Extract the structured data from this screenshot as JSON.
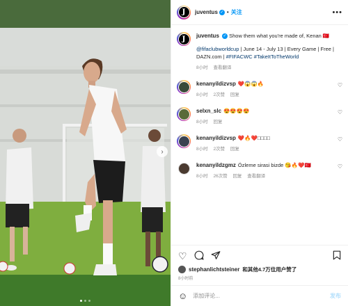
{
  "header": {
    "username": "juventus",
    "verified_mark": "✓",
    "separator": "•",
    "follow_label": "关注",
    "more_label": "•••"
  },
  "photo": {
    "next_label": "›",
    "slide_count": 3,
    "active_slide": 1
  },
  "caption": {
    "username": "juventus",
    "text": "Show them what you're made of, Kenan 🇹🇷",
    "line2_mention": "@fifaclubworldcup",
    "line2_rest": " | June 14 - July 13 | Every Game | Free | DAZN.com | ",
    "line2_tags": "#FIFACWC #TakeItToTheWorld",
    "time": "8小时",
    "translate": "查看翻译"
  },
  "comments": [
    {
      "username": "kenanyildizvsp",
      "text": "❤️😱😱🔥",
      "time": "8小时",
      "likes": "2次赞",
      "reply": "回复"
    },
    {
      "username": "selxn_slc",
      "text": "😍😍😍😍",
      "time": "8小时",
      "likes": "",
      "reply": "回复"
    },
    {
      "username": "kenanyildizvsp",
      "text": "❤️🔥❤️□□□□",
      "time": "8小时",
      "likes": "2次赞",
      "reply": "回复"
    },
    {
      "username": "kenanyildzgmz",
      "text": "Özleme sirasi bizde 😘🔥❤️🇹🇷",
      "time": "8小时",
      "likes": "26次赞",
      "reply": "回复",
      "translate": "查看翻译"
    }
  ],
  "likes": {
    "user": "stephanlichtsteiner",
    "rest": "和其他4.7万位用户赞了"
  },
  "time_ago": "8小时前",
  "add_comment": {
    "emoji_icon": "☺",
    "placeholder": "添加评论...",
    "post_label": "发布"
  },
  "colors": {
    "accent": "#0095f6",
    "link": "#00376b",
    "muted": "#8e8e8e"
  }
}
